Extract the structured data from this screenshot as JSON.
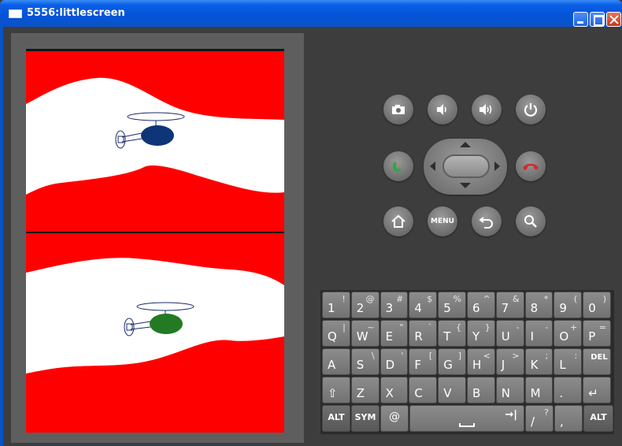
{
  "window": {
    "title": "5556:littlescreen"
  },
  "buttons": {
    "camera": "camera-icon",
    "volume_down": "volume-down-icon",
    "volume_up": "volume-up-icon",
    "power": "power-icon",
    "call": "call-icon",
    "end_call": "end-call-icon",
    "home": "home-icon",
    "menu_label": "MENU",
    "back": "back-icon",
    "search": "search-icon"
  },
  "game": {
    "colors": {
      "terrain": "#ff0000",
      "cave": "#ffffff",
      "helicopter_top": "#0d3578",
      "helicopter_bottom": "#237a23",
      "outline": "#1a2a6e"
    }
  },
  "keyboard": {
    "row1": [
      {
        "p": "1",
        "s": "!"
      },
      {
        "p": "2",
        "s": "@"
      },
      {
        "p": "3",
        "s": "#"
      },
      {
        "p": "4",
        "s": "$"
      },
      {
        "p": "5",
        "s": "%"
      },
      {
        "p": "6",
        "s": "^"
      },
      {
        "p": "7",
        "s": "&"
      },
      {
        "p": "8",
        "s": "*"
      },
      {
        "p": "9",
        "s": "("
      },
      {
        "p": "0",
        "s": ")"
      }
    ],
    "row2": [
      {
        "p": "Q",
        "s": "|"
      },
      {
        "p": "W",
        "s": "~"
      },
      {
        "p": "E",
        "s": "\""
      },
      {
        "p": "R",
        "s": "`"
      },
      {
        "p": "T",
        "s": "{"
      },
      {
        "p": "Y",
        "s": "}"
      },
      {
        "p": "U",
        "s": "-"
      },
      {
        "p": "I",
        "s": "-"
      },
      {
        "p": "O",
        "s": "+"
      },
      {
        "p": "P",
        "s": "="
      }
    ],
    "row3": [
      {
        "p": "A",
        "s": ""
      },
      {
        "p": "S",
        "s": "\\"
      },
      {
        "p": "D",
        "s": "'"
      },
      {
        "p": "F",
        "s": "["
      },
      {
        "p": "G",
        "s": "]"
      },
      {
        "p": "H",
        "s": "<"
      },
      {
        "p": "J",
        "s": ">"
      },
      {
        "p": "K",
        "s": ";"
      },
      {
        "p": "L",
        "s": ":"
      },
      {
        "p": "DEL",
        "s": ""
      }
    ],
    "row4": [
      {
        "p": "⇧",
        "s": ""
      },
      {
        "p": "Z",
        "s": ""
      },
      {
        "p": "X",
        "s": ""
      },
      {
        "p": "C",
        "s": ""
      },
      {
        "p": "V",
        "s": ""
      },
      {
        "p": "B",
        "s": ""
      },
      {
        "p": "N",
        "s": ""
      },
      {
        "p": "M",
        "s": ""
      },
      {
        "p": ".",
        "s": ""
      },
      {
        "p": "↵",
        "s": ""
      }
    ],
    "row5": {
      "alt_left": "ALT",
      "sym": "SYM",
      "at": "@",
      "space_arrow": "→|",
      "slash": "/",
      "slash_s": "?",
      "comma": ",",
      "alt_right": "ALT"
    }
  }
}
